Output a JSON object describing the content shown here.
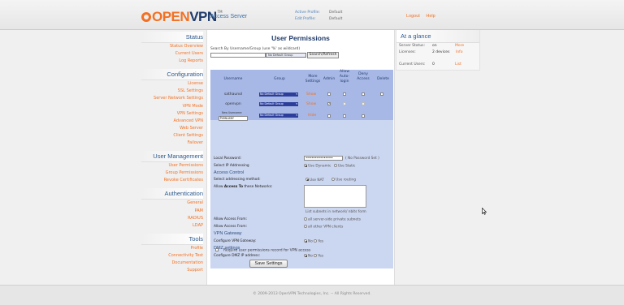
{
  "header": {
    "logo_text_open": "OPEN",
    "logo_text_vpn": "VPN",
    "logo_tm": "TM",
    "subtitle": "Access Server",
    "active_profile_label": "Active Profile:",
    "active_profile_value": "Default",
    "edit_profile_label": "Edit Profile:",
    "edit_profile_value": "Default",
    "logout": "Logout",
    "help": "Help"
  },
  "sidebar": {
    "status": {
      "title": "Status",
      "items": [
        "Status Overview",
        "Current Users",
        "Log Reports"
      ]
    },
    "configuration": {
      "title": "Configuration",
      "items": [
        "License",
        "SSL Settings",
        "Server Network Settings",
        "VPN Mode",
        "VPN Settings",
        "Advanced VPN",
        "Web Server",
        "Client Settings",
        "Failover"
      ]
    },
    "user_management": {
      "title": "User Management",
      "items": [
        "User Permissions",
        "Group Permissions",
        "Revoke Certificates"
      ]
    },
    "authentication": {
      "title": "Authentication",
      "items": [
        "General",
        "PAM",
        "RADIUS",
        "LDAP"
      ]
    },
    "tools": {
      "title": "Tools",
      "items": [
        "Profile",
        "Connectivity Test",
        "Documentation",
        "Support"
      ]
    }
  },
  "main": {
    "title": "User Permissions",
    "search_label": "Search By Username/Group (use '%' as wildcard)",
    "search_value": "",
    "search_group": "No Default Group",
    "search_button": "Search/Refresh",
    "columns": {
      "username": "Username",
      "group": "Group",
      "more_settings": "More Settings",
      "admin": "Admin",
      "allow_auto_login": "Allow Auto-login",
      "deny_access": "Deny Access",
      "delete": "Delete"
    },
    "rows": [
      {
        "username": "sathaunol",
        "group": "No Default Group",
        "action": "Show",
        "admin": "",
        "auto": "",
        "deny": "",
        "delete": ""
      },
      {
        "username": "openvpn",
        "group": "No Default Group",
        "action": "Show",
        "admin": "✓",
        "auto": "",
        "deny": "",
        "delete": ""
      }
    ],
    "new_user": {
      "label": "New Username:",
      "value": "hewuser",
      "group": "No Default Group",
      "action": "Hide"
    },
    "details": {
      "local_password_label": "Local Password:",
      "local_password_value": "••••••••••••••••••",
      "local_password_note": "( No Password Set )",
      "select_ip_label": "Select IP Addressing",
      "use_dynamic": "Use Dynamic",
      "use_static": "Use Static",
      "access_control_heading": "Access Control",
      "select_method_label": "Select addressing method:",
      "use_nat": "Use NAT",
      "use_routing": "Use routing",
      "allow_access_networks_prefix": "Allow ",
      "allow_access_networks_bold": "Access To",
      "allow_access_networks_suffix": " these Networks:",
      "subnet_hint": "List subnets in network/ nbits form",
      "allow_access_from_1": "Allow Access From:",
      "all_server_side": "all server-side private subnets",
      "allow_access_from_2": "Allow Access From:",
      "all_other_vpn": "all other VPN clients",
      "vpn_gateway_heading": "VPN Gateway",
      "configure_gateway_label": "Configure VPN Gateway:",
      "dmz_heading": "DMZ settings",
      "configure_dmz_label": "Configure DMZ IP address:",
      "no": "No",
      "yes": "Yes"
    },
    "require_permissions": "Require user permissions record for VPN access",
    "save_button": "Save Settings"
  },
  "glance": {
    "title": "At a glance",
    "server_status_label": "Server Status:",
    "server_status_value": "on",
    "server_status_link": "More",
    "licenses_label": "Licenses:",
    "licenses_value": "2 devices",
    "licenses_link": "Info",
    "current_users_label": "Current Users:",
    "current_users_value": "0",
    "current_users_link": "List"
  },
  "footer": "© 2009-2013 OpenVPN Technologies, Inc. -- All Rights Reserved.",
  "colors": {
    "accent": "#f37022",
    "brand": "#1f3b6b",
    "table_header": "#a7b8e6",
    "table_body": "#cbd6f0"
  }
}
